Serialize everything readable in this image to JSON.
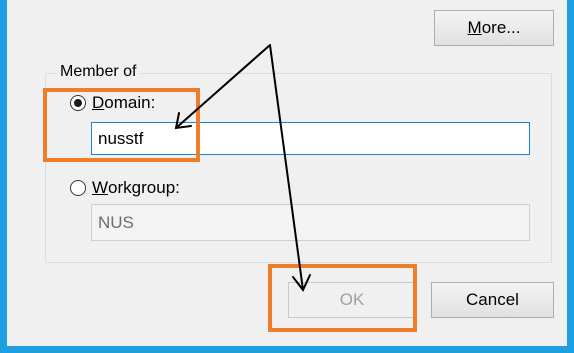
{
  "dialog": {
    "more_button": {
      "label_underlined": "M",
      "label_rest": "ore..."
    },
    "member_of": {
      "legend": "Member of",
      "domain": {
        "label_underlined": "D",
        "label_rest": "omain:",
        "selected": true,
        "value": "nusstf"
      },
      "workgroup": {
        "label_underlined": "W",
        "label_rest": "orkgroup:",
        "selected": false,
        "value": "NUS"
      }
    },
    "ok_button": {
      "label": "OK",
      "enabled": false
    },
    "cancel_button": {
      "label": "Cancel"
    }
  },
  "annotation": {
    "highlight_color": "#f07d2a",
    "arrow_color": "#000000"
  },
  "colors": {
    "window_border": "#1d9fe0",
    "dialog_background": "#f0f0f0",
    "focused_field_border": "#1883d7"
  }
}
